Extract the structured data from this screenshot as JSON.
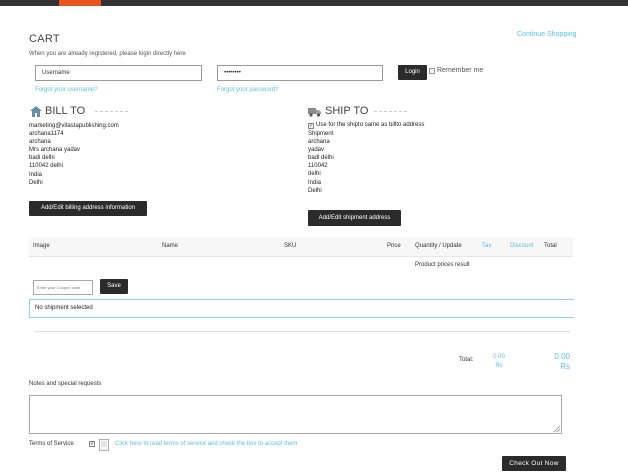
{
  "header": {
    "continue_shopping": "Continue Shopping"
  },
  "cart": {
    "title": "CART",
    "login_hint": "When you are already registered, please login directly here",
    "username_value": "Username",
    "password_value": "••••••••",
    "login_label": "Login",
    "remember_label": "Remember me",
    "forgot_username": "Forgot your username?",
    "forgot_password": "Forgot your password?"
  },
  "bill_to": {
    "title": "BILL TO",
    "lines": [
      "marketing@vitastapublishing.com",
      "archana1174",
      "archana",
      "Mrs archana  yadav",
      "badi delhi",
      "110042 delhi",
      "India",
      "Delhi"
    ],
    "button": "Add/Edit billing address information"
  },
  "ship_to": {
    "title": "SHIP TO",
    "same_as_billto": "Use for the shipto same as billto address",
    "lines": [
      "Shipment",
      "archana",
      "yadav",
      "badi delhi",
      "110042",
      "delhi",
      "India",
      "Delhi"
    ],
    "button": "Add/Edit shipment address"
  },
  "table": {
    "columns": {
      "image": "Image",
      "name": "Name",
      "sku": "SKU",
      "price": "Price",
      "qty": "Quantity / Update",
      "tax": "Tax",
      "discount": "Discount",
      "total": "Total"
    },
    "prices_note": "Product prices result"
  },
  "coupon": {
    "placeholder": "Enter your Coupon code",
    "save": "Save"
  },
  "shipment": {
    "status": "No shipment selected"
  },
  "totals": {
    "label": "Total:",
    "tax_value": "0.00",
    "tax_currency": "Rs",
    "total_value": "0.00",
    "total_currency": "Rs"
  },
  "notes": {
    "label": "Notes and special requests"
  },
  "tos": {
    "label": "Terms of Service",
    "link": "Click here to read terms of service and check the box to accept them."
  },
  "checkout": {
    "label": "Check Out Now"
  },
  "colors": {
    "accent": "#e8541e",
    "link": "#5bc0de",
    "dark_button": "#2b2b2b"
  }
}
